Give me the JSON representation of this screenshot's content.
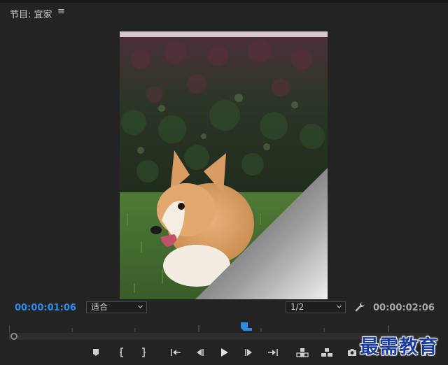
{
  "panel": {
    "title": "节目: 宜家",
    "menu_icon": "hamburger-menu-icon"
  },
  "playback": {
    "current_timecode": "00:00:01:06",
    "total_timecode": "00:00:02:06",
    "zoom_fit": "适合",
    "resolution": "1/2",
    "playhead_fraction": 0.56
  },
  "controls": [
    {
      "name": "add-marker-button",
      "icon": "marker-icon"
    },
    {
      "name": "mark-in-button",
      "icon": "mark-in-icon"
    },
    {
      "name": "mark-out-button",
      "icon": "mark-out-icon"
    },
    {
      "name": "go-to-in-button",
      "icon": "go-to-in-icon"
    },
    {
      "name": "step-back-button",
      "icon": "step-back-icon"
    },
    {
      "name": "play-button",
      "icon": "play-icon"
    },
    {
      "name": "step-forward-button",
      "icon": "step-forward-icon"
    },
    {
      "name": "go-to-out-button",
      "icon": "go-to-out-icon"
    },
    {
      "name": "lift-button",
      "icon": "lift-icon"
    },
    {
      "name": "extract-button",
      "icon": "extract-icon"
    },
    {
      "name": "export-frame-button",
      "icon": "camera-icon"
    },
    {
      "name": "button-editor",
      "icon": "plus-icon"
    }
  ],
  "watermark": "最需教育",
  "colors": {
    "background": "#232323",
    "timecode_accent": "#2d8ceb",
    "playhead": "#2d8ceb"
  }
}
